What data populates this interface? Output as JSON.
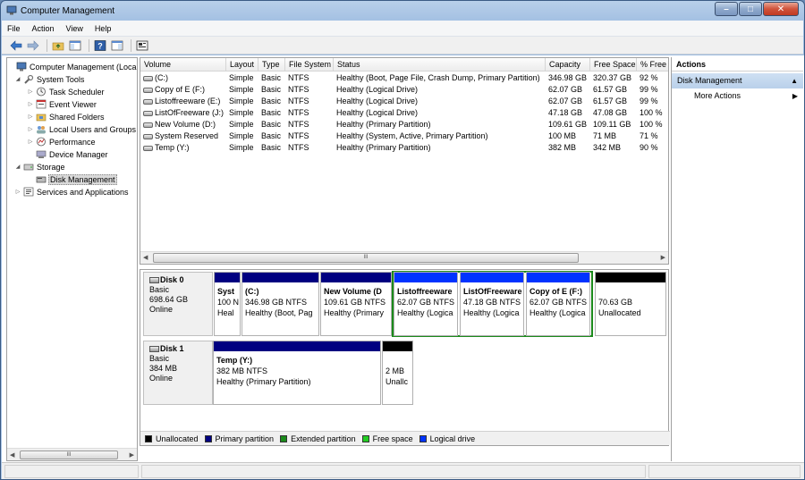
{
  "window": {
    "title": "Computer Management",
    "controls": {
      "minimize": "–",
      "maximize": "□",
      "close": "✕"
    }
  },
  "menu": [
    "File",
    "Action",
    "View",
    "Help"
  ],
  "tree": [
    {
      "label": "Computer Management (Local",
      "level": 0,
      "expander": "",
      "icon": "computer-icon"
    },
    {
      "label": "System Tools",
      "level": 1,
      "expander": "◢",
      "icon": "tools-icon"
    },
    {
      "label": "Task Scheduler",
      "level": 2,
      "expander": "▷",
      "icon": "clock-icon"
    },
    {
      "label": "Event Viewer",
      "level": 2,
      "expander": "▷",
      "icon": "event-viewer-icon"
    },
    {
      "label": "Shared Folders",
      "level": 2,
      "expander": "▷",
      "icon": "shared-folder-icon"
    },
    {
      "label": "Local Users and Groups",
      "level": 2,
      "expander": "▷",
      "icon": "users-icon"
    },
    {
      "label": "Performance",
      "level": 2,
      "expander": "▷",
      "icon": "performance-icon"
    },
    {
      "label": "Device Manager",
      "level": 2,
      "expander": "",
      "icon": "device-manager-icon"
    },
    {
      "label": "Storage",
      "level": 1,
      "expander": "◢",
      "icon": "storage-icon"
    },
    {
      "label": "Disk Management",
      "level": 2,
      "expander": "",
      "icon": "disk-management-icon",
      "selected": true
    },
    {
      "label": "Services and Applications",
      "level": 1,
      "expander": "▷",
      "icon": "services-icon"
    }
  ],
  "volumes": {
    "headers": [
      "Volume",
      "Layout",
      "Type",
      "File System",
      "Status",
      "Capacity",
      "Free Space",
      "% Free"
    ],
    "rows": [
      [
        "(C:)",
        "Simple",
        "Basic",
        "NTFS",
        "Healthy (Boot, Page File, Crash Dump, Primary Partition)",
        "346.98 GB",
        "320.37 GB",
        "92 %"
      ],
      [
        "Copy of E (F:)",
        "Simple",
        "Basic",
        "NTFS",
        "Healthy (Logical Drive)",
        "62.07 GB",
        "61.57 GB",
        "99 %"
      ],
      [
        "Listoffreeware (E:)",
        "Simple",
        "Basic",
        "NTFS",
        "Healthy (Logical Drive)",
        "62.07 GB",
        "61.57 GB",
        "99 %"
      ],
      [
        "ListOfFreeware (J:)",
        "Simple",
        "Basic",
        "NTFS",
        "Healthy (Logical Drive)",
        "47.18 GB",
        "47.08 GB",
        "100 %"
      ],
      [
        "New Volume (D:)",
        "Simple",
        "Basic",
        "NTFS",
        "Healthy (Primary Partition)",
        "109.61 GB",
        "109.11 GB",
        "100 %"
      ],
      [
        "System Reserved",
        "Simple",
        "Basic",
        "NTFS",
        "Healthy (System, Active, Primary Partition)",
        "100 MB",
        "71 MB",
        "71 %"
      ],
      [
        "Temp (Y:)",
        "Simple",
        "Basic",
        "NTFS",
        "Healthy (Primary Partition)",
        "382 MB",
        "342 MB",
        "90 %"
      ]
    ],
    "scroll_thumb_label": "III"
  },
  "disks": [
    {
      "name": "Disk 0",
      "type": "Basic",
      "size": "698.64 GB",
      "status": "Online",
      "partitions": [
        {
          "name": "Syst",
          "line2": "100 N",
          "line3": "Heal",
          "color": "#000080"
        },
        {
          "name": "(C:)",
          "line2": "346.98 GB NTFS",
          "line3": "Healthy (Boot, Pag",
          "color": "#000080"
        },
        {
          "name": "New Volume  (D",
          "line2": "109.61 GB NTFS",
          "line3": "Healthy (Primary",
          "color": "#000080"
        },
        {
          "name": "Listoffreeware",
          "line2": "62.07 GB NTFS",
          "line3": "Healthy (Logica",
          "color": "#0033ff"
        },
        {
          "name": "ListOfFreeware",
          "line2": "47.18 GB NTFS",
          "line3": "Healthy (Logica",
          "color": "#0033ff"
        },
        {
          "name": "Copy of E  (F:)",
          "line2": "62.07 GB NTFS",
          "line3": "Healthy (Logica",
          "color": "#0033ff"
        },
        {
          "name": "",
          "line2": "70.63 GB",
          "line3": "Unallocated",
          "color": "#000000"
        }
      ]
    },
    {
      "name": "Disk 1",
      "type": "Basic",
      "size": "384 MB",
      "status": "Online",
      "partitions": [
        {
          "name": "Temp  (Y:)",
          "line2": "382 MB NTFS",
          "line3": "Healthy (Primary Partition)",
          "color": "#000080"
        },
        {
          "name": "",
          "line2": "2 MB",
          "line3": "Unallc",
          "color": "#000000"
        }
      ]
    }
  ],
  "legend": [
    {
      "label": "Unallocated",
      "color": "#000000"
    },
    {
      "label": "Primary partition",
      "color": "#000080"
    },
    {
      "label": "Extended partition",
      "color": "#1b8a1b"
    },
    {
      "label": "Free space",
      "color": "#22cc22"
    },
    {
      "label": "Logical drive",
      "color": "#0033ff"
    }
  ],
  "actions": {
    "header": "Actions",
    "section": "Disk Management",
    "items": [
      "More Actions"
    ]
  },
  "tree_scroll_label": "III",
  "colors": {
    "accent_selection": "#b9d0ea",
    "extended_frame": "#1b8a1b"
  }
}
